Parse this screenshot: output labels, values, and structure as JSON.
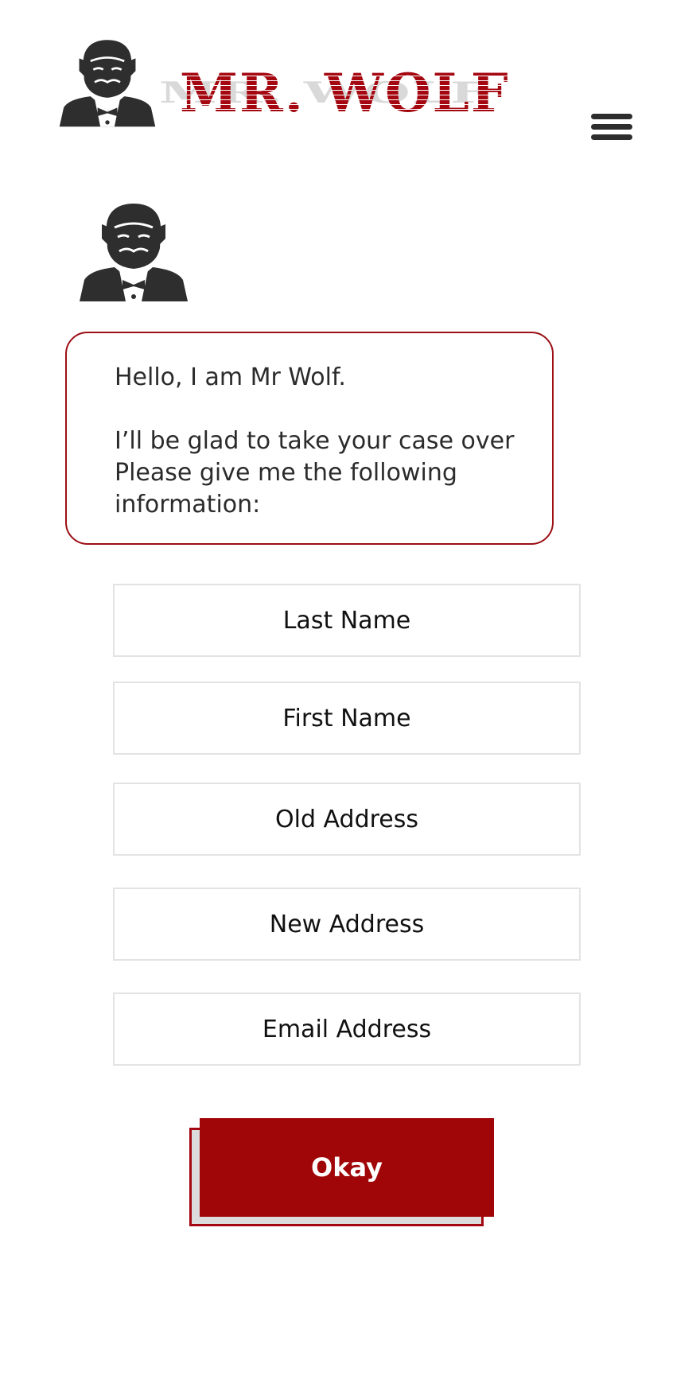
{
  "header": {
    "brand_name": "MR. WOLF",
    "brand_color": "#a40710",
    "menu_icon": "hamburger-menu-icon"
  },
  "avatar": {
    "icon": "mr-wolf-portrait-icon"
  },
  "speech": {
    "greeting": "Hello, I am Mr Wolf.",
    "line1": "I’ll be glad to take your case over",
    "line2": "Please give me the following information:"
  },
  "form": {
    "last_name_placeholder": "Last Name",
    "first_name_placeholder": "First Name",
    "old_address_placeholder": "Old Address",
    "new_address_placeholder": "New Address",
    "email_placeholder": "Email Address",
    "submit_label": "Okay",
    "submit_color": "#a00508"
  }
}
